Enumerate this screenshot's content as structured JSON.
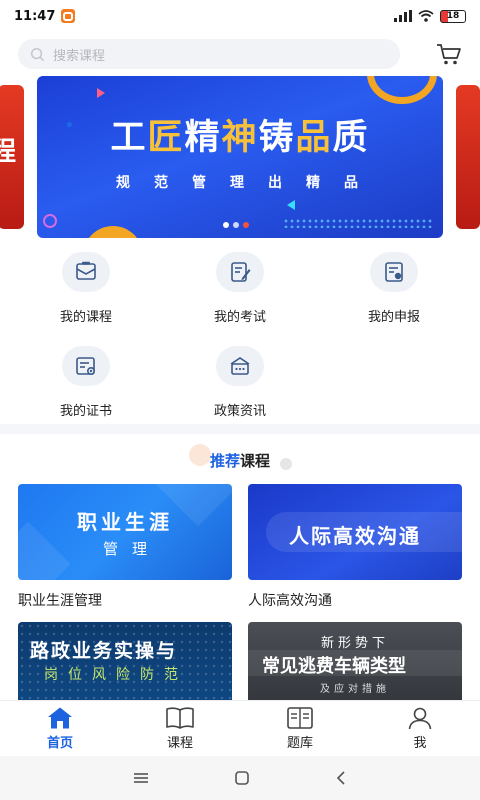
{
  "status_bar": {
    "time": "11:47",
    "battery": "18"
  },
  "search": {
    "placeholder": "搜索课程"
  },
  "banner": {
    "title_parts": [
      "工",
      "匠",
      "精",
      "神",
      "铸",
      "品",
      "质"
    ],
    "subtitle": "规范管理出精品"
  },
  "menu": {
    "items": [
      {
        "label": "我的课程",
        "icon": "course-icon"
      },
      {
        "label": "我的考试",
        "icon": "exam-icon"
      },
      {
        "label": "我的申报",
        "icon": "declare-icon"
      },
      {
        "label": "我的证书",
        "icon": "certificate-icon"
      },
      {
        "label": "政策资讯",
        "icon": "policy-icon"
      }
    ]
  },
  "recommended": {
    "title_accent": "推荐",
    "title_rest": "课程"
  },
  "courses": [
    {
      "name": "职业生涯管理",
      "thumb_main": "职业生涯",
      "thumb_sub": "管理"
    },
    {
      "name": "人际高效沟通",
      "thumb_main": "人际高效沟通"
    },
    {
      "thumb_main": "路政业务实操与",
      "thumb_sub": "岗位风险防范"
    },
    {
      "thumb_top": "新形势下",
      "thumb_main": "常见逃费车辆类型",
      "thumb_sub": "及应对措施"
    }
  ],
  "tabbar": {
    "items": [
      {
        "label": "首页",
        "icon": "home-icon",
        "active": true
      },
      {
        "label": "课程",
        "icon": "book-icon",
        "active": false
      },
      {
        "label": "题库",
        "icon": "question-bank-icon",
        "active": false
      },
      {
        "label": "我",
        "icon": "profile-icon",
        "active": false
      }
    ]
  },
  "colors": {
    "accent": "#1d63e0",
    "banner_yellow": "#f7c13a"
  }
}
